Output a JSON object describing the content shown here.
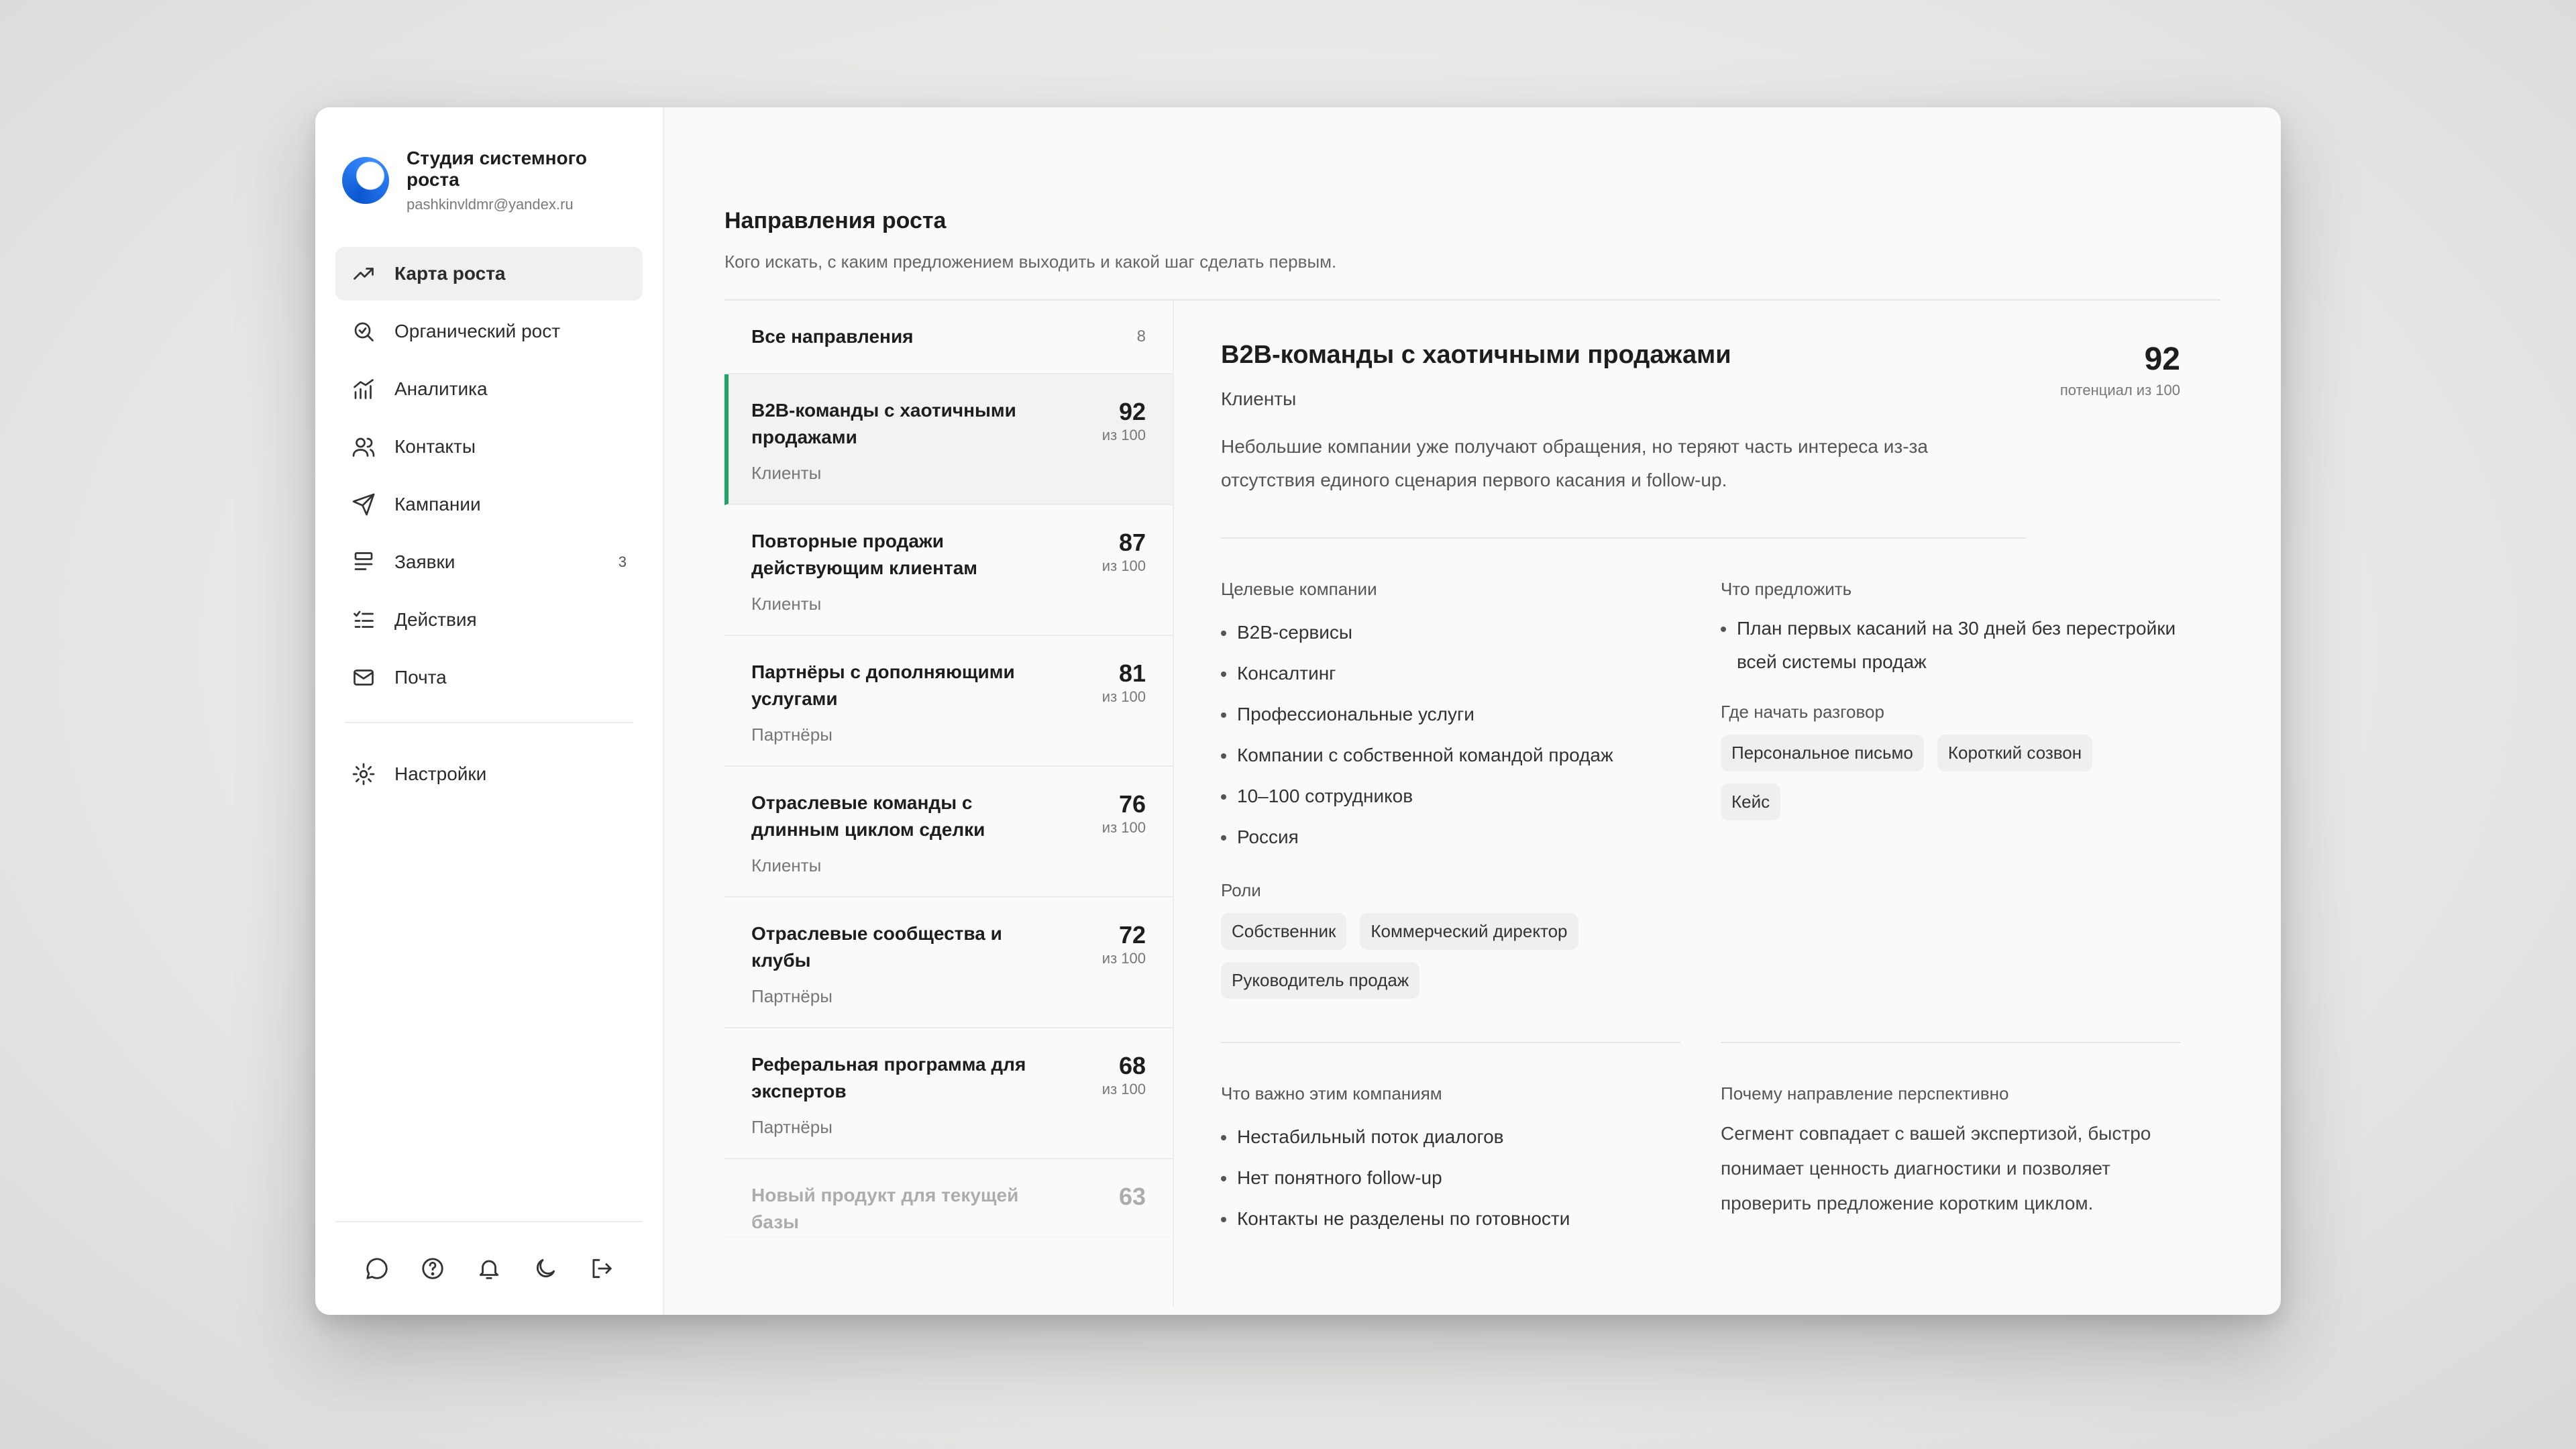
{
  "brand": {
    "title": "Студия системного роста",
    "email": "pashkinvldmr@yandex.ru"
  },
  "nav": [
    {
      "label": "Карта роста",
      "icon": "trend-up-icon",
      "active": true
    },
    {
      "label": "Органический рост",
      "icon": "search-check-icon"
    },
    {
      "label": "Аналитика",
      "icon": "chart-icon"
    },
    {
      "label": "Контакты",
      "icon": "users-icon"
    },
    {
      "label": "Кампании",
      "icon": "send-icon"
    },
    {
      "label": "Заявки",
      "icon": "inbox-list-icon",
      "badge": "3"
    },
    {
      "label": "Действия",
      "icon": "checklist-icon"
    },
    {
      "label": "Почта",
      "icon": "mail-icon"
    }
  ],
  "settings_label": "Настройки",
  "footer_icons": [
    "chat-icon",
    "help-icon",
    "bell-icon",
    "moon-icon",
    "logout-icon"
  ],
  "page": {
    "title": "Направления роста",
    "subtitle": "Кого искать, с каким предложением выходить и какой шаг сделать первым."
  },
  "list": {
    "all_label": "Все направления",
    "all_count": "8",
    "score_suffix": "из 100",
    "items": [
      {
        "name": "B2B-команды с хаотичными продажами",
        "type": "Клиенты",
        "score": "92"
      },
      {
        "name": "Повторные продажи действующим клиентам",
        "type": "Клиенты",
        "score": "87"
      },
      {
        "name": "Партнёры с дополняющими услугами",
        "type": "Партнёры",
        "score": "81"
      },
      {
        "name": "Отраслевые команды с длинным циклом сделки",
        "type": "Клиенты",
        "score": "76"
      },
      {
        "name": "Отраслевые сообщества и клубы",
        "type": "Партнёры",
        "score": "72"
      },
      {
        "name": "Реферальная программа для экспертов",
        "type": "Партнёры",
        "score": "68"
      },
      {
        "name": "Новый продукт для текущей базы",
        "type": "",
        "score": "63"
      }
    ]
  },
  "detail": {
    "title": "B2B-команды с хаотичными продажами",
    "category": "Клиенты",
    "score": "92",
    "score_label": "потенциал из 100",
    "description": "Небольшие компании уже получают обращения, но теряют часть интереса из-за отсутствия единого сценария первого касания и follow-up.",
    "targets_title": "Целевые компании",
    "targets": [
      "B2B-сервисы",
      "Консалтинг",
      "Профессиональные услуги",
      "Компании с собственной командой продаж",
      "10–100 сотрудников",
      "Россия"
    ],
    "roles_title": "Роли",
    "roles": [
      "Собственник",
      "Коммерческий директор",
      "Руководитель продаж"
    ],
    "offer_title": "Что предложить",
    "offer": [
      "План первых касаний на 30 дней без перестройки всей системы продаж"
    ],
    "start_title": "Где начать разговор",
    "start_channels": [
      "Персональное письмо",
      "Короткий созвон",
      "Кейс"
    ],
    "important_title": "Что важно этим компаниям",
    "important": [
      "Нестабильный поток диалогов",
      "Нет понятного follow-up",
      "Контакты не разделены по готовности"
    ],
    "why_title": "Почему направление перспективно",
    "why": "Сегмент совпадает с вашей экспертизой, быстро понимает ценность диагностики и позволяет проверить предложение коротким циклом."
  }
}
